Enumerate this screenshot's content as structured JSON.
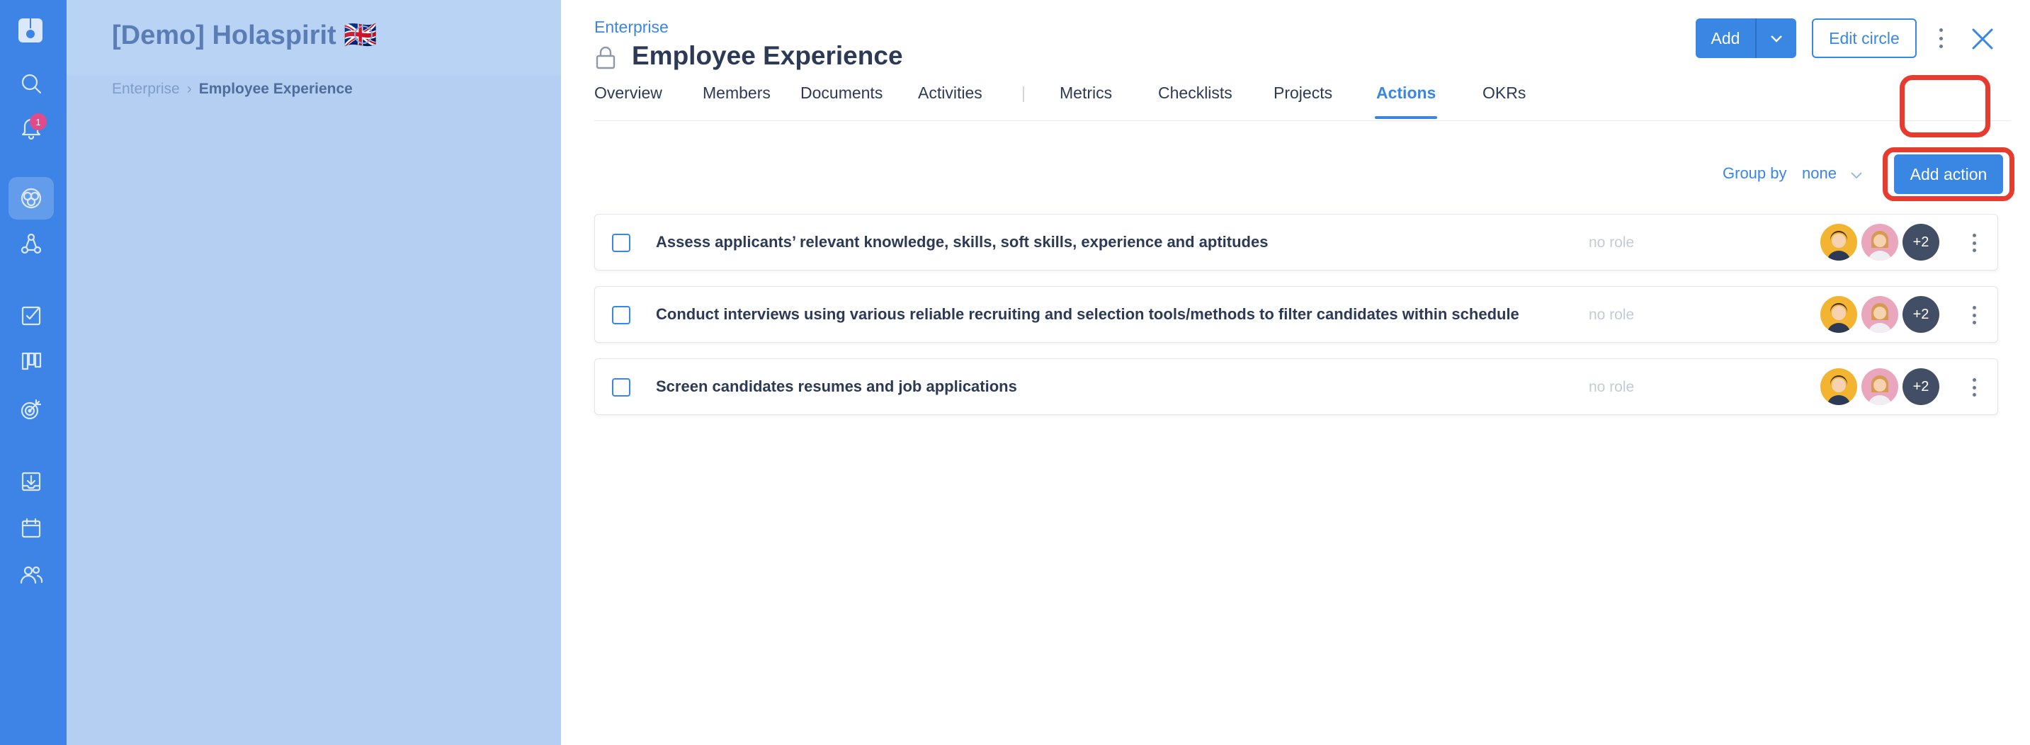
{
  "rail": {
    "icons": [
      "holaspirit-logo-icon",
      "search-icon",
      "bell-icon",
      "circles-icon",
      "roles-icon",
      "tasks-icon",
      "board-icon",
      "target-icon",
      "inbox-icon",
      "calendar-icon",
      "people-icon"
    ],
    "notification_count": "1",
    "accent_color": "#3d84e6"
  },
  "background": {
    "org_title": "[Demo] Holaspirit 🇬🇧",
    "breadcrumb": [
      "Enterprise",
      "Employee Experience"
    ]
  },
  "header": {
    "parent": "Enterprise",
    "title": "Employee Experience",
    "add_label": "Add",
    "edit_label": "Edit circle"
  },
  "tabs": [
    "Overview",
    "Members",
    "Documents",
    "Activities",
    "Metrics",
    "Checklists",
    "Projects",
    "Actions",
    "OKRs"
  ],
  "active_tab": "Actions",
  "toolbar": {
    "group_by_label": "Group by",
    "group_by_value": "none",
    "add_action_label": "Add action"
  },
  "actions": [
    {
      "text": "Assess applicants’ relevant knowledge, skills, soft skills, experience and aptitudes",
      "role": "no role",
      "extra_assignees": "+2",
      "checked": false
    },
    {
      "text": "Conduct interviews using various reliable recruiting and selection tools/methods to filter candidates within schedule",
      "role": "no role",
      "extra_assignees": "+2",
      "checked": false
    },
    {
      "text": "Screen candidates resumes and job applications",
      "role": "no role",
      "extra_assignees": "+2",
      "checked": false
    }
  ],
  "highlight_color": "#e63b2e"
}
